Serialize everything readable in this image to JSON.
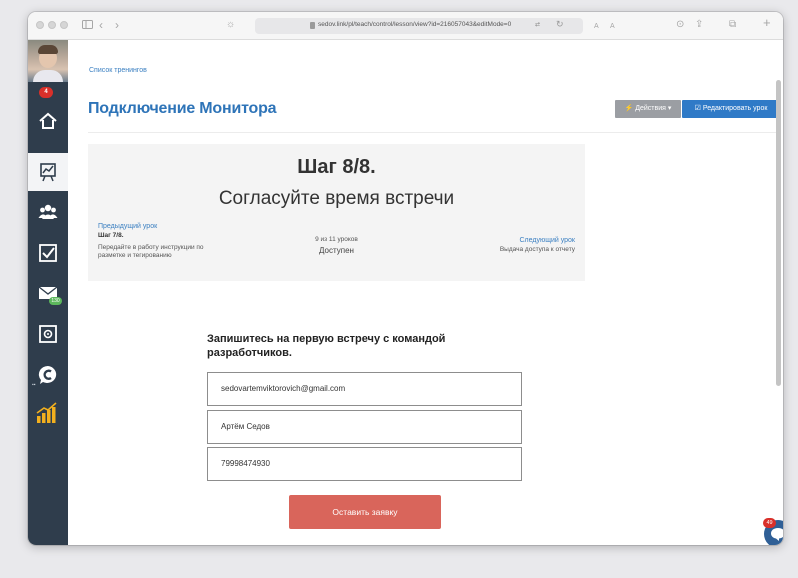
{
  "browser": {
    "url": "sedov.link/pl/teach/control/lesson/view?id=216057043&editMode=0",
    "translate_label": "A",
    "text_size_label": "A"
  },
  "sidebar": {
    "notification_count": "4",
    "mail_count": "130",
    "items": [
      {
        "icon": "home-icon"
      },
      {
        "icon": "chart-board-icon",
        "active": true
      },
      {
        "icon": "users-icon"
      },
      {
        "icon": "checkbox-icon"
      },
      {
        "icon": "mail-icon"
      },
      {
        "icon": "safe-icon"
      },
      {
        "icon": "chat-c-icon"
      },
      {
        "icon": "growth-chart-icon"
      }
    ]
  },
  "page": {
    "breadcrumb": "Список тренингов",
    "title": "Подключение Монитора",
    "actions_button": "⚡ Действия ▾",
    "edit_button": "Редактировать урок"
  },
  "step": {
    "title": "Шаг 8/8.",
    "subtitle": "Согласуйте время встречи",
    "prev_label": "Предыдущий урок",
    "prev_step": "Шаг 7/8.",
    "prev_desc": "Передайте в работу инструкции по разметке и тегированию",
    "lesson_count": "9 из 11 уроков",
    "status": "Доступен",
    "next_label": "Следующий урок",
    "next_desc": "Выдача доступа к отчету"
  },
  "form": {
    "heading": "Запишитесь на первую встречу с командой разработчиков.",
    "email": "sedovartemviktorovich@gmail.com",
    "name": "Артём Седов",
    "phone": "79998474930",
    "submit": "Оставить заявку"
  },
  "chat": {
    "badge": "49"
  },
  "colors": {
    "sidebar": "#2f3d4c",
    "link": "#3a7fc1",
    "title": "#2e74b8",
    "edit_button": "#2f7ac7",
    "submit_button": "#d9655b",
    "badge": "#d9302a"
  }
}
